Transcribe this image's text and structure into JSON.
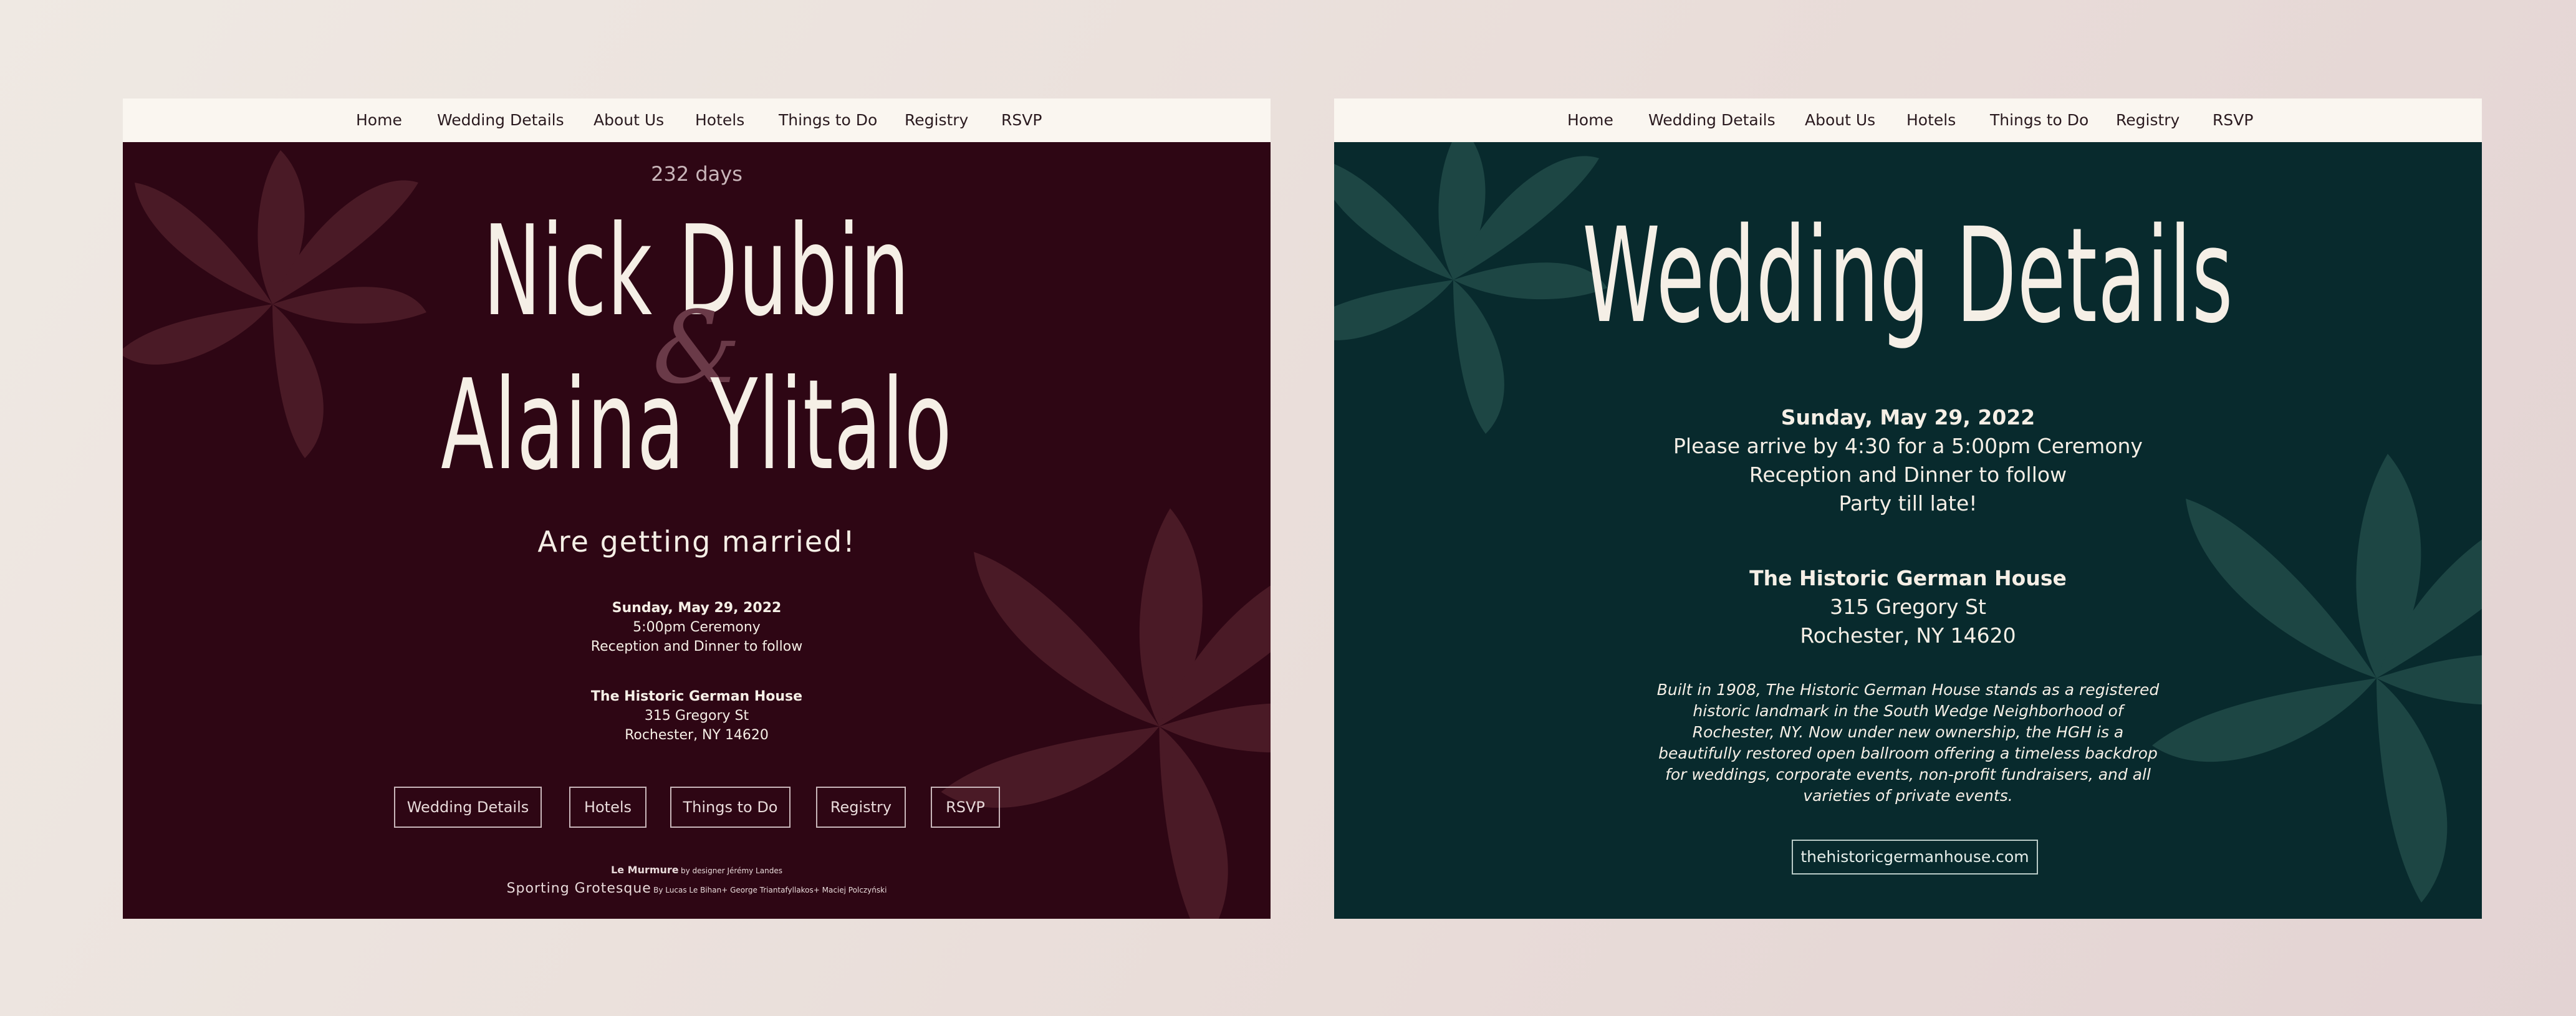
{
  "nav": {
    "items": [
      "Home",
      "Wedding Details",
      "About Us",
      "Hotels",
      "Things to Do",
      "Registry",
      "RSVP"
    ]
  },
  "home": {
    "countdown": "232 days",
    "name_1": "Nick Dubin",
    "ampersand": "&",
    "name_2": "Alaina Ylitalo",
    "tagline": "Are getting married!",
    "event": {
      "date": "Sunday, May 29, 2022",
      "time": "5:00pm Ceremony",
      "reception": "Reception and Dinner to follow"
    },
    "venue": {
      "name": "The Historic German House",
      "street": "315 Gregory St",
      "city": "Rochester, NY 14620"
    },
    "buttons": [
      "Wedding Details",
      "Hotels",
      "Things to Do",
      "Registry",
      "RSVP"
    ],
    "credits": {
      "font_1_name": "Le Murmure",
      "font_1_credit": "by designer Jérémy Landes",
      "font_2_name": "Sporting Grotesque",
      "font_2_credit": "By Lucas Le Bihan+ George Triantafyllakos+ Maciej Polczyński"
    }
  },
  "details": {
    "title": "Wedding Details",
    "date": "Sunday, May 29, 2022",
    "arrive": "Please arrive by 4:30 for a 5:00pm Ceremony",
    "reception": "Reception and Dinner to follow",
    "party": "Party till late!",
    "venue_name": "The Historic German House",
    "venue_street": "315 Gregory St",
    "venue_city": "Rochester, NY 14620",
    "description_lines": [
      "Built in 1908, The Historic German House stands as a registered",
      "historic landmark in the South Wedge Neighborhood of",
      "Rochester, NY. Now under new ownership, the HGH is a",
      "beautifully restored open ballroom offering a timeless backdrop",
      "for weddings, corporate events, non-profit fundraisers, and all",
      "varieties of private events."
    ],
    "website": "thehistoricgermanhouse.com"
  },
  "colors": {
    "background": "#ece3de",
    "nav_bg": "#faf6f0",
    "burgundy": "#2e0614",
    "burgundy_flower": "#4a1a26",
    "teal": "#082a2d",
    "teal_flower": "#1d4644",
    "cream_text": "#f5efe6"
  },
  "icons": [
    "flower-decoration-icon"
  ]
}
